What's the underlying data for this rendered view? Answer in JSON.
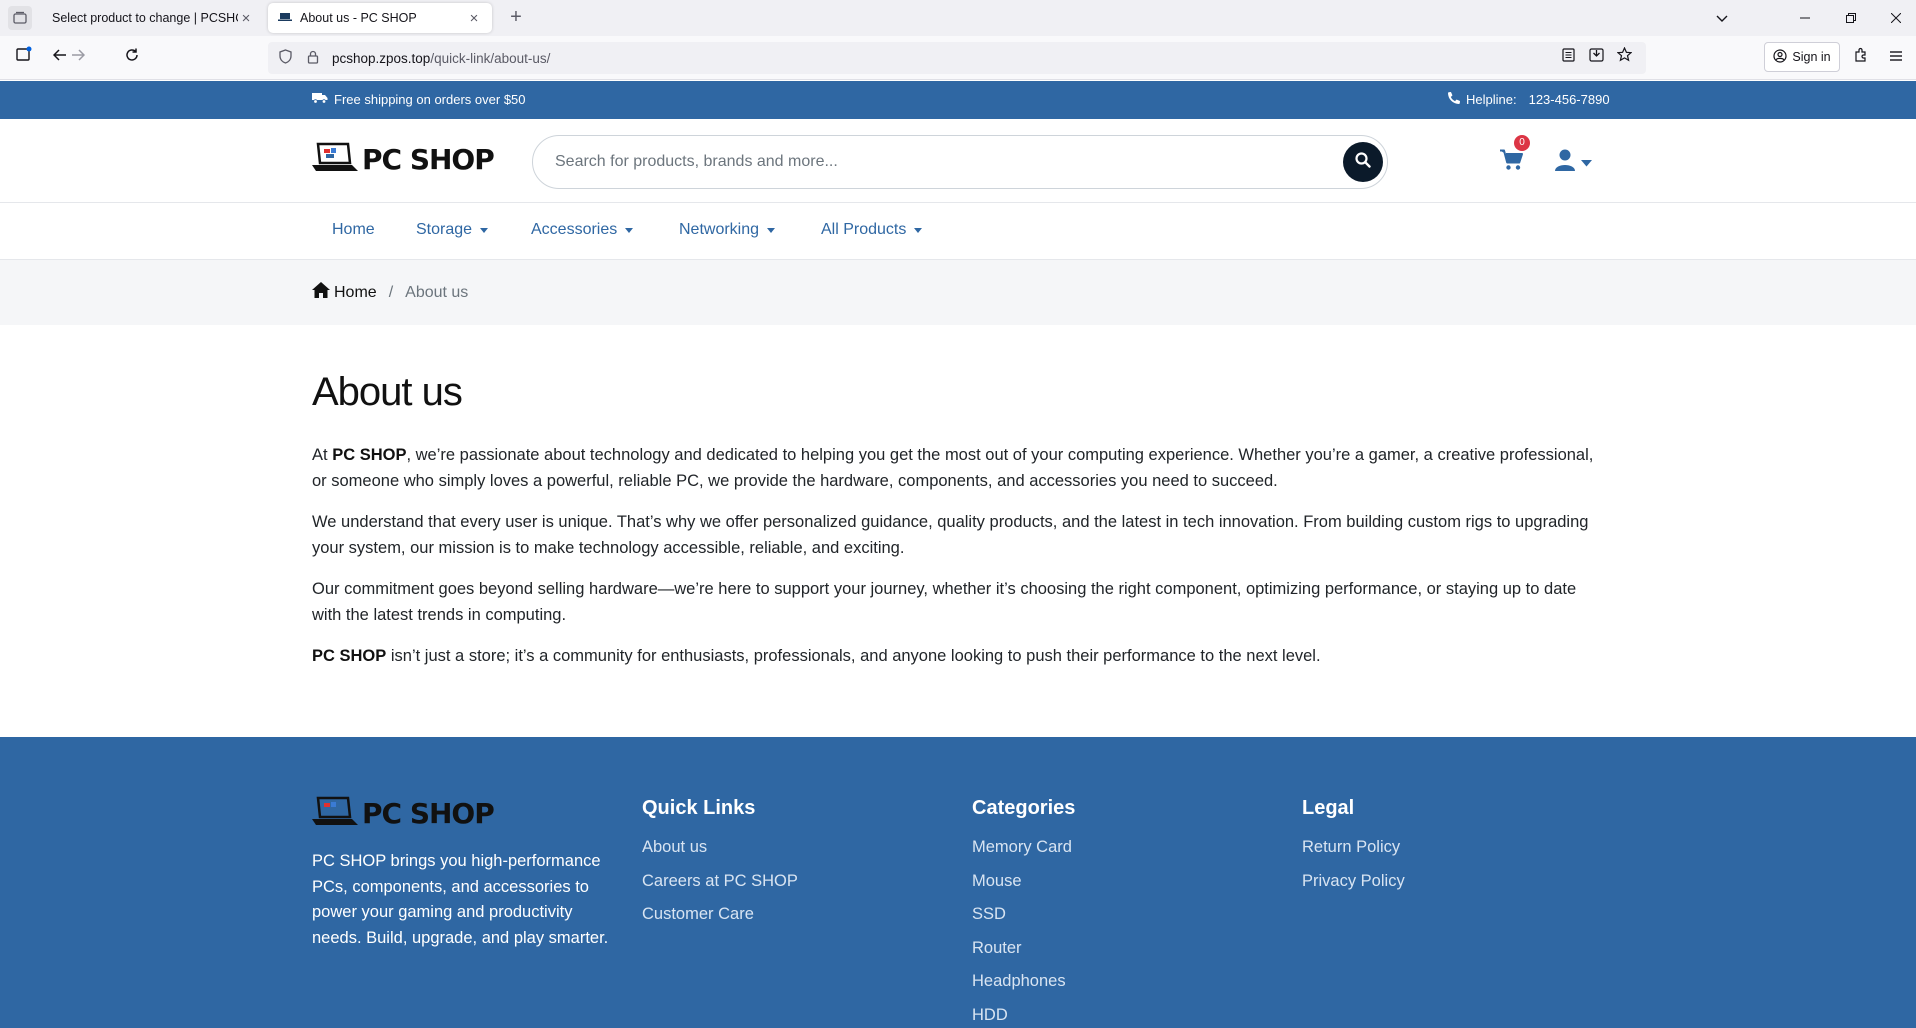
{
  "browser": {
    "tabs": [
      {
        "title": "Select product to change | PCSHOP",
        "active": false
      },
      {
        "title": "About us - PC SHOP",
        "active": true
      }
    ],
    "url_host": "pcshop.zpos.top",
    "url_path": "/quick-link/about-us/",
    "signin_label": "Sign in"
  },
  "topbar": {
    "shipping": "Free shipping on orders over $50",
    "helpline_label": "Helpline:",
    "helpline_number": "123-456-7890"
  },
  "brand": {
    "name": "PC SHOP"
  },
  "search": {
    "placeholder": "Search for products, brands and more..."
  },
  "cart": {
    "count": "0"
  },
  "nav": {
    "home": "Home",
    "storage": "Storage",
    "accessories": "Accessories",
    "networking": "Networking",
    "all_products": "All Products"
  },
  "breadcrumb": {
    "home": "Home",
    "separator": "/",
    "current": "About us"
  },
  "page": {
    "title": "About us",
    "p1_pre": "At ",
    "p1_brand": "PC SHOP",
    "p1_post": ", we’re passionate about technology and dedicated to helping you get the most out of your computing experience. Whether you’re a gamer, a creative professional, or someone who simply loves a powerful, reliable PC, we provide the hardware, components, and accessories you need to succeed.",
    "p2": "We understand that every user is unique. That’s why we offer personalized guidance, quality products, and the latest in tech innovation. From building custom rigs to upgrading your system, our mission is to make technology accessible, reliable, and exciting.",
    "p3": "Our commitment goes beyond selling hardware—we’re here to support your journey, whether it’s choosing the right component, optimizing performance, or staying up to date with the latest trends in computing.",
    "p4_brand": "PC SHOP",
    "p4_post": " isn’t just a store; it’s a community for enthusiasts, professionals, and anyone looking to push their performance to the next level."
  },
  "footer": {
    "about": "PC SHOP brings you high-performance PCs, components, and accessories to power your gaming and productivity needs. Build, upgrade, and play smarter.",
    "quick_links": {
      "title": "Quick Links",
      "items": [
        "About us",
        "Careers at PC SHOP",
        "Customer Care"
      ]
    },
    "categories": {
      "title": "Categories",
      "items": [
        "Memory Card",
        "Mouse",
        "SSD",
        "Router",
        "Headphones",
        "HDD"
      ]
    },
    "legal": {
      "title": "Legal",
      "items": [
        "Return Policy",
        "Privacy Policy"
      ]
    }
  },
  "colors": {
    "brand_blue": "#2f67a3",
    "dark": "#0b1a2a",
    "badge_red": "#dc3545"
  }
}
